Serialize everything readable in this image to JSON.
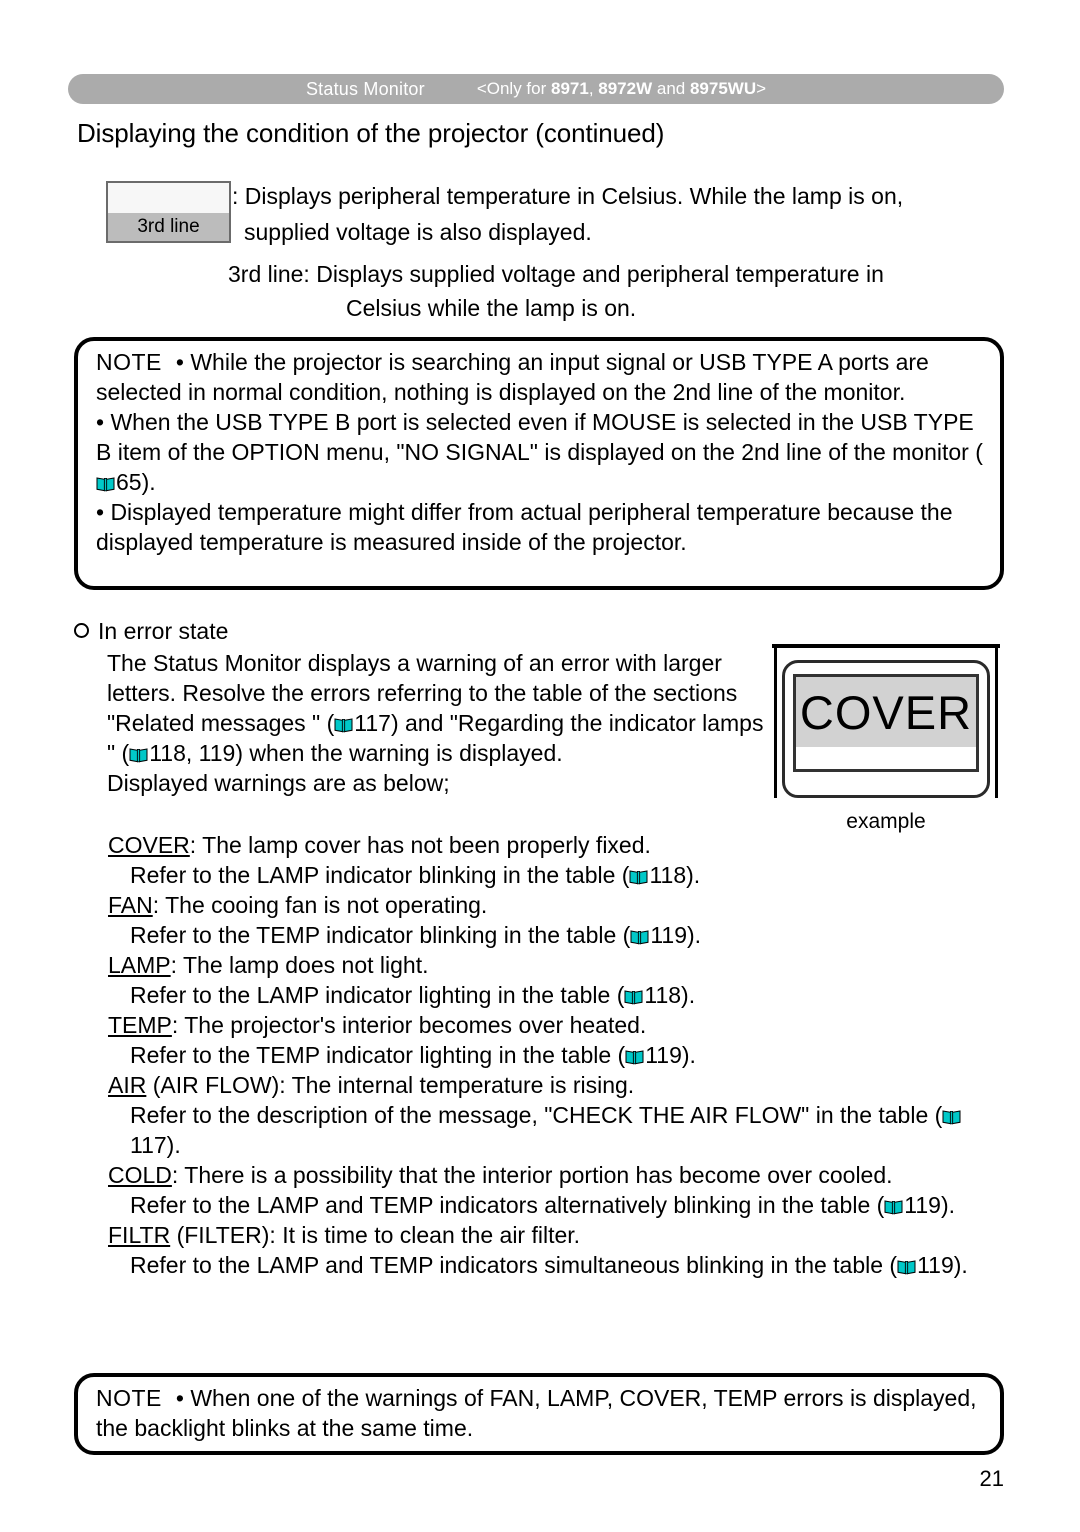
{
  "header": {
    "title": "Status Monitor",
    "only_prefix": "<Only for ",
    "model1": "8971",
    "sep1": ", ",
    "model2": "8972W",
    "sep2": " and ",
    "model3": "8975WU",
    "only_suffix": ">",
    "bar_color": "#ababab",
    "text_color": "#ffffff"
  },
  "page_title": "Displaying the condition of the projector (continued)",
  "chip": {
    "label": "3rd line",
    "desc_line1": ": Displays peripheral temperature in Celsius. While the lamp is on,",
    "desc_line2": "supplied voltage is also displayed."
  },
  "thirdline_def": {
    "line1": "3rd line:  Displays supplied voltage and peripheral temperature in",
    "line2": "Celsius while the lamp is on."
  },
  "note_top": {
    "keyword": "NOTE",
    "bullet1": "• While the projector is searching an input signal or USB TYPE A ports are selected in normal condition, nothing is displayed on the 2nd line of the monitor.",
    "bullet2_a": "• When the USB TYPE B port is selected even if MOUSE is selected in the USB TYPE B item of the OPTION menu, \"NO SIGNAL\" is displayed on the 2nd line of the monitor (",
    "bullet2_page": "65",
    "bullet2_b": ").",
    "bullet3": "• Displayed temperature might differ from actual peripheral temperature because the displayed temperature is measured inside of the projector."
  },
  "error_section": {
    "heading": "In error state",
    "para_a": "The Status Monitor displays a warning of an error with larger letters. Resolve the errors referring to the table of the sections \"Related messages \" (",
    "para_page1": "117",
    "para_b": ") and \"Regarding the indicator lamps   \" (",
    "para_page2": "118, 119",
    "para_c": ") when the warning is displayed.",
    "para_d": "Displayed warnings are as below;"
  },
  "warnings": [
    {
      "code": "COVER",
      "code_suffix": "",
      "text": ": The lamp cover has not been properly fixed.",
      "sub_a": "Refer to the LAMP indicator blinking in the table (",
      "sub_page": "118",
      "sub_b": ")."
    },
    {
      "code": "FAN",
      "code_suffix": "",
      "text": ": The cooing fan is not operating.",
      "sub_a": "Refer to the TEMP indicator blinking in the table (",
      "sub_page": "119",
      "sub_b": ")."
    },
    {
      "code": "LAMP",
      "code_suffix": "",
      "text": ": The lamp does not light.",
      "sub_a": "Refer to the LAMP indicator lighting in the table (",
      "sub_page": "118",
      "sub_b": ")."
    },
    {
      "code": "TEMP",
      "code_suffix": "",
      "text": ": The projector's interior becomes over heated.",
      "sub_a": "Refer to the TEMP indicator lighting in the table (",
      "sub_page": "119",
      "sub_b": ")."
    },
    {
      "code": "AIR",
      "code_suffix": " (AIR FLOW)",
      "text": ": The internal temperature is rising.",
      "sub_a": "Refer to the description of the message, \"CHECK THE AIR FLOW\" in the table (",
      "sub_page": "117",
      "sub_b": ")."
    },
    {
      "code": "COLD",
      "code_suffix": "",
      "text": ": There is a possibility that the interior portion has become over cooled.",
      "sub_a": "Refer to the LAMP and TEMP indicators alternatively blinking in the table (",
      "sub_page": "119",
      "sub_b": ")."
    },
    {
      "code": "FILTR",
      "code_suffix": " (FILTER)",
      "text": ": It is time to clean the air filter.",
      "sub_a": "Refer to the LAMP and TEMP indicators simultaneous blinking in the table (",
      "sub_page": "119",
      "sub_b": ")."
    }
  ],
  "example": {
    "display_text": "COVER",
    "caption": "example",
    "band_color": "#d2d2d2"
  },
  "note_bottom": {
    "keyword": "NOTE",
    "bullet1": "• When one of the warnings of FAN, LAMP, COVER, TEMP errors is displayed, the backlight blinks at the same time."
  },
  "page_number": "21",
  "book_icon_color": "#00c8c8"
}
